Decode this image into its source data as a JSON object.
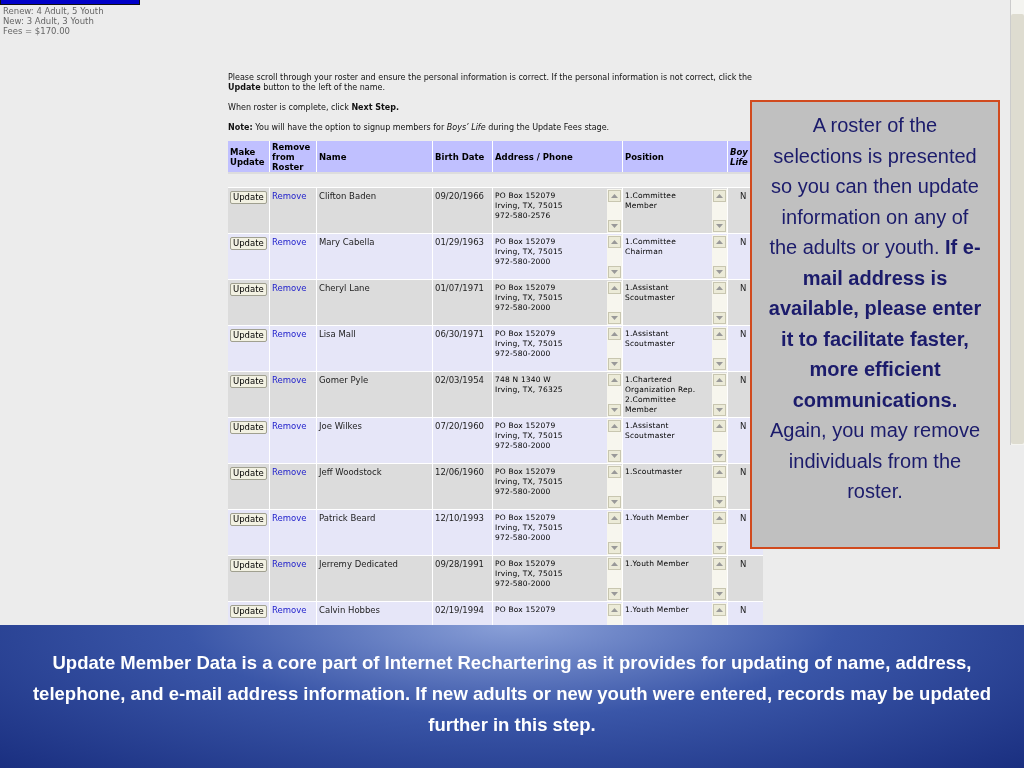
{
  "summary": [
    "Renew: 4 Adult, 5 Youth",
    "New: 3 Adult, 3 Youth",
    "Fees = $170.00"
  ],
  "instructions": [
    "Please scroll through your roster and ensure the personal information is correct. If the personal information is not correct, click the **Update** button to the left of the name.",
    "When roster is complete, click **Next Step.**",
    "**Note:** You will have the option to signup members for *Boys’ Life* during the Update Fees stage."
  ],
  "table": {
    "columns": [
      "Make Update",
      "Remove from Roster",
      "Name",
      "Birth Date",
      "Address / Phone",
      "Position",
      "Boy Life"
    ],
    "rows": [
      {
        "update": "Update",
        "remove": "Remove",
        "name": "Clifton Baden",
        "birth_date": "09/20/1966",
        "address": [
          "PO Box 152079",
          "Irving, TX, 75015",
          "972-580-2576"
        ],
        "position": [
          "1.Committee",
          "Member"
        ],
        "boys_life": "N"
      },
      {
        "update": "Update",
        "remove": "Remove",
        "name": "Mary Cabella",
        "birth_date": "01/29/1963",
        "address": [
          "PO Box 152079",
          "Irving, TX, 75015",
          "972-580-2000"
        ],
        "position": [
          "1.Committee",
          "Chairman"
        ],
        "boys_life": "N"
      },
      {
        "update": "Update",
        "remove": "Remove",
        "name": "Cheryl Lane",
        "birth_date": "01/07/1971",
        "address": [
          "PO Box 152079",
          "Irving, TX, 75015",
          "972-580-2000"
        ],
        "position": [
          "1.Assistant",
          "Scoutmaster"
        ],
        "boys_life": "N"
      },
      {
        "update": "Update",
        "remove": "Remove",
        "name": "Lisa Mall",
        "birth_date": "06/30/1971",
        "address": [
          "PO Box 152079",
          "Irving, TX, 75015",
          "972-580-2000"
        ],
        "position": [
          "1.Assistant",
          "Scoutmaster"
        ],
        "boys_life": "N"
      },
      {
        "update": "Update",
        "remove": "Remove",
        "name": "Gomer Pyle",
        "birth_date": "02/03/1954",
        "address": [
          "748 N 1340 W",
          "Irving, TX, 76325"
        ],
        "position": [
          "1.Chartered",
          "Organization Rep.",
          "2.Committee",
          "Member"
        ],
        "boys_life": "N"
      },
      {
        "update": "Update",
        "remove": "Remove",
        "name": "Joe Wilkes",
        "birth_date": "07/20/1960",
        "address": [
          "PO Box 152079",
          "Irving, TX, 75015",
          "972-580-2000"
        ],
        "position": [
          "1.Assistant",
          "Scoutmaster"
        ],
        "boys_life": "N"
      },
      {
        "update": "Update",
        "remove": "Remove",
        "name": "Jeff Woodstock",
        "birth_date": "12/06/1960",
        "address": [
          "PO Box 152079",
          "Irving, TX, 75015",
          "972-580-2000"
        ],
        "position": [
          "1.Scoutmaster"
        ],
        "boys_life": "N"
      },
      {
        "update": "Update",
        "remove": "Remove",
        "name": "Patrick Beard",
        "birth_date": "12/10/1993",
        "address": [
          "PO Box 152079",
          "Irving, TX, 75015",
          "972-580-2000"
        ],
        "position": [
          "1.Youth Member"
        ],
        "boys_life": "N"
      },
      {
        "update": "Update",
        "remove": "Remove",
        "name": "Jerremy Dedicated",
        "birth_date": "09/28/1991",
        "address": [
          "PO Box 152079",
          "Irving, TX, 75015",
          "972-580-2000"
        ],
        "position": [
          "1.Youth Member"
        ],
        "boys_life": "N"
      },
      {
        "update": "Update",
        "remove": "Remove",
        "name": "Calvin Hobbes",
        "birth_date": "02/19/1994",
        "address": [
          "PO Box 152079"
        ],
        "position": [
          "1.Youth Member"
        ],
        "boys_life": "N"
      }
    ]
  },
  "callout": "A roster of the selections is presented so you can then update information on any of the adults or youth. **If e-mail address is available, please enter it to facilitate faster, more efficient communications.** Again, you may remove individuals from the roster.",
  "banner": "Update Member Data is a core part of Internet Rechartering as it provides for updating of name, address, telephone, and e-mail address information. If new adults or new youth were entered, records may be updated further in this step."
}
